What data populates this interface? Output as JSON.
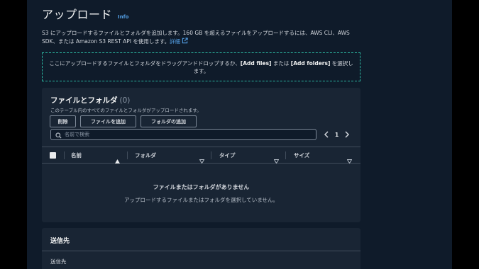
{
  "header": {
    "title": "アップロード",
    "info_link": "Info"
  },
  "description": {
    "text": "S3 にアップロードするファイルとフォルダを追加します。160 GB を超えるファイルをアップロードするには、AWS CLI、AWS SDK、または Amazon S3 REST API を使用します。",
    "details_link": "詳細"
  },
  "dropzone": {
    "text_before": "ここにアップロードするファイルとフォルダをドラッグアンドドロップするか、",
    "add_files": "[Add files]",
    "text_mid": " または ",
    "add_folders": "[Add folders]",
    "text_after": " を選択します。"
  },
  "files_panel": {
    "title": "ファイルとフォルダ",
    "count": "(0)",
    "subtitle": "このテーブル内のすべてのファイルとフォルダがアップロードされます。",
    "buttons": {
      "delete": "削除",
      "add_files": "ファイルを追加",
      "add_folder": "フォルダの追加"
    },
    "search": {
      "placeholder": "名前で検索",
      "value": ""
    },
    "pagination": {
      "current_page": "1"
    },
    "columns": {
      "name": "名前",
      "folder": "フォルダ",
      "type": "タイプ",
      "size": "サイズ"
    },
    "empty_state": {
      "title": "ファイルまたはフォルダがありません",
      "subtitle": "アップロードするファイルまたはフォルダを選択していません。"
    }
  },
  "destination_panel": {
    "title": "送信先",
    "label": "送信先"
  },
  "colors": {
    "page_bg": "#0f1b2a",
    "panel_bg": "#192534",
    "outer_bg": "#000000",
    "link": "#539fe5",
    "dropzone_border": "#2bb5a0",
    "divider": "#414d5c"
  },
  "icons": {
    "details_link": "external-link-icon",
    "search": "search-icon",
    "prev_page": "chevron-left-icon",
    "next_page": "chevron-right-icon",
    "name_sort": "sort-ascending-icon",
    "column_sort": "sort-descending-icon"
  }
}
